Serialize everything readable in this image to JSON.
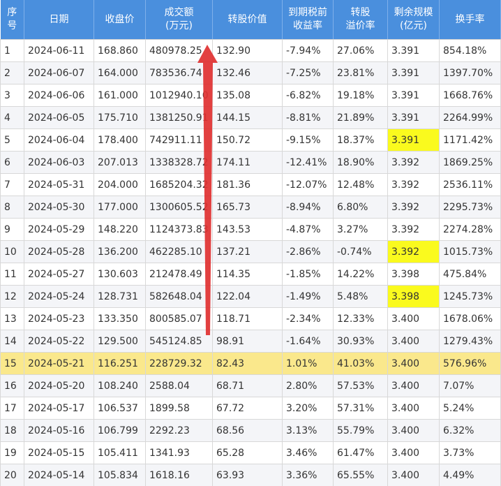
{
  "table": {
    "headers": [
      "序\n号",
      "日期",
      "收盘价",
      "成交额\n(万元)",
      "转股价值",
      "到期税前\n收益率",
      "转股\n溢价率",
      "剩余规模\n(亿元)",
      "换手率"
    ],
    "rows": [
      [
        "1",
        "2024-06-11",
        "168.860",
        "480978.25",
        "132.90",
        "-7.94%",
        "27.06%",
        "3.391",
        "854.18%"
      ],
      [
        "2",
        "2024-06-07",
        "164.000",
        "783536.74",
        "132.46",
        "-7.25%",
        "23.81%",
        "3.391",
        "1397.70%"
      ],
      [
        "3",
        "2024-06-06",
        "161.000",
        "1012940.10",
        "135.08",
        "-6.82%",
        "19.18%",
        "3.391",
        "1668.76%"
      ],
      [
        "4",
        "2024-06-05",
        "175.710",
        "1381250.91",
        "144.15",
        "-8.81%",
        "21.89%",
        "3.391",
        "2264.99%"
      ],
      [
        "5",
        "2024-06-04",
        "178.400",
        "742911.11",
        "150.72",
        "-9.15%",
        "18.37%",
        "3.391",
        "1171.42%"
      ],
      [
        "6",
        "2024-06-03",
        "207.013",
        "1338328.72",
        "174.11",
        "-12.41%",
        "18.90%",
        "3.392",
        "1869.25%"
      ],
      [
        "7",
        "2024-05-31",
        "204.000",
        "1685204.32",
        "181.36",
        "-12.07%",
        "12.48%",
        "3.392",
        "2536.11%"
      ],
      [
        "8",
        "2024-05-30",
        "177.000",
        "1300605.52",
        "165.73",
        "-8.94%",
        "6.80%",
        "3.392",
        "2295.73%"
      ],
      [
        "9",
        "2024-05-29",
        "148.220",
        "1124373.83",
        "143.53",
        "-4.87%",
        "3.27%",
        "3.392",
        "2274.28%"
      ],
      [
        "10",
        "2024-05-28",
        "136.200",
        "462285.10",
        "137.21",
        "-2.86%",
        "-0.74%",
        "3.392",
        "1015.73%"
      ],
      [
        "11",
        "2024-05-27",
        "130.603",
        "212478.49",
        "114.35",
        "-1.85%",
        "14.22%",
        "3.398",
        "475.84%"
      ],
      [
        "12",
        "2024-05-24",
        "128.731",
        "582648.04",
        "122.04",
        "-1.49%",
        "5.48%",
        "3.398",
        "1245.73%"
      ],
      [
        "13",
        "2024-05-23",
        "133.350",
        "800585.07",
        "118.71",
        "-2.34%",
        "12.33%",
        "3.400",
        "1678.06%"
      ],
      [
        "14",
        "2024-05-22",
        "129.500",
        "545124.85",
        "98.91",
        "-1.64%",
        "30.93%",
        "3.400",
        "1279.43%"
      ],
      [
        "15",
        "2024-05-21",
        "116.251",
        "228729.32",
        "82.43",
        "1.01%",
        "41.03%",
        "3.400",
        "576.96%"
      ],
      [
        "16",
        "2024-05-20",
        "108.240",
        "2588.04",
        "68.71",
        "2.80%",
        "57.53%",
        "3.400",
        "7.07%"
      ],
      [
        "17",
        "2024-05-17",
        "106.537",
        "1899.58",
        "67.72",
        "3.20%",
        "57.31%",
        "3.400",
        "5.24%"
      ],
      [
        "18",
        "2024-05-16",
        "106.799",
        "2292.23",
        "68.56",
        "3.13%",
        "55.79%",
        "3.400",
        "6.32%"
      ],
      [
        "19",
        "2024-05-15",
        "105.411",
        "1341.93",
        "65.28",
        "3.46%",
        "61.47%",
        "3.400",
        "3.73%"
      ],
      [
        "20",
        "2024-05-14",
        "105.834",
        "1618.16",
        "63.93",
        "3.36%",
        "65.55%",
        "3.400",
        "4.49%"
      ]
    ],
    "highlight_row_index": 14,
    "yellow_cells": [
      [
        4,
        7
      ],
      [
        9,
        7
      ],
      [
        11,
        7
      ]
    ]
  },
  "colors": {
    "header_bg": "#4a8fdd",
    "row_highlight": "#fae88c",
    "cell_highlight": "#fafa1e",
    "arrow": "#e03030"
  },
  "annotation": {
    "icon": "red-arrow-up-icon"
  }
}
